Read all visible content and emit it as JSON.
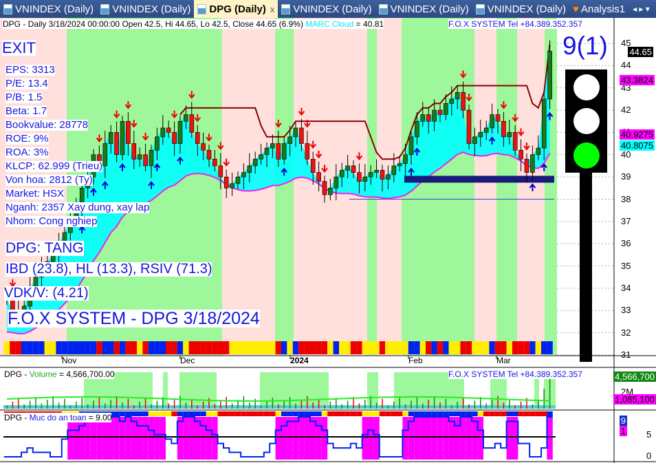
{
  "tabs": [
    {
      "label": "VNINDEX (Daily)"
    },
    {
      "label": "VNINDEX (Daily)"
    },
    {
      "label": "DPG (Daily)",
      "active": true
    },
    {
      "label": "VNINDEX (Daily)"
    },
    {
      "label": "VNINDEX (Daily)"
    },
    {
      "label": "VNINDEX (Daily)"
    },
    {
      "label": "Analysis1"
    }
  ],
  "tab_close": "x",
  "tab_nav": "◂ ▸ ▾",
  "header": {
    "text": "DPG - Daily 3/18/2024 00:00:00 Open 42.5, Hi 44.65, Lo 42.5, Close 44.65 (6.9%)",
    "marc_label": "MARC Cloud",
    "marc_value": "= 40.81",
    "fox": "F.O.X SYSTEM Tel +84.389.352.357"
  },
  "signal": "EXIT",
  "fundamentals": [
    "EPS: 3313",
    "P/E: 13.4",
    "P/B: 1.5",
    "Beta: 1.7",
    "Bookvalue: 28778",
    "ROE: 9%",
    "ROA: 3%",
    "KLCP: 62.999 (Trieu)",
    "Von hoa: 2812 (Ty)",
    "Market: HSX",
    "Nganh: 2357 Xay dung, xay lap",
    "Nhom: Cong nghiep"
  ],
  "trend": "DPG: TANG",
  "ratings": "IBD (23.8), HL (13.3), RSIV (71.3)",
  "vdk": "VDK/V:  (4.21)",
  "footer_title": "F.O.X SYSTEM - DPG 3/18/2024",
  "score": "9(1)",
  "price_tags": {
    "last": "44.65",
    "upper": "43.3824",
    "mid": "40.9275",
    "cloud": "40.8075"
  },
  "volume_pane": {
    "title": "DPG - ",
    "label": "Volume",
    "value": "= 4,566,700.00",
    "fox": "F.O.X SYSTEM Tel +84.389.352.357",
    "tag_last": "4,566,700",
    "tag_avg": "1,085,100",
    "axis": "2M"
  },
  "safety_pane": {
    "title": "DPG - ",
    "label": "Muc do an toan",
    "value": "= 9.00",
    "tag_value": "9",
    "tag_signal": "1",
    "axis": [
      "5",
      "0"
    ]
  },
  "colors": {
    "up": "#1a7a1a",
    "down": "#ee1111",
    "green_band": "#9ef79a",
    "pink_band": "#ffe0dc",
    "marc": "#ee22ee",
    "cloud": "#00ffff"
  },
  "chart_data": {
    "type": "candlestick",
    "title": "DPG - Daily",
    "x_labels": [
      "Nov",
      "Dec",
      "2024",
      "Feb",
      "Mar"
    ],
    "y_ticks": [
      31,
      32,
      33,
      34,
      35,
      36,
      37,
      38,
      39,
      40,
      41,
      42,
      43,
      44,
      45
    ],
    "ylim": [
      31,
      45
    ],
    "closes": [
      33.5,
      33,
      32.8,
      33.2,
      34,
      34.5,
      35,
      35.2,
      35.5,
      36,
      36.5,
      37,
      37.5,
      38.5,
      39,
      40,
      39.5,
      40.5,
      41,
      40,
      41.5,
      40.5,
      39.8,
      40,
      39.5,
      40.2,
      40.8,
      41.2,
      41,
      40.5,
      41.5,
      41.8,
      41,
      40.5,
      40.2,
      39.8,
      39.5,
      39,
      38.5,
      38.7,
      39,
      39.2,
      39.5,
      39.8,
      40,
      40.3,
      40.5,
      39.8,
      40.5,
      40.8,
      41.2,
      40.5,
      39.8,
      39.2,
      38.8,
      38.2,
      38.5,
      39,
      39.3,
      39.5,
      39.2,
      38.8,
      39,
      39.2,
      39.3,
      38.9,
      39.1,
      39.5,
      39.6,
      40,
      40.8,
      41.5,
      41.8,
      41.5,
      42,
      41.8,
      42.3,
      42.5,
      42.8,
      42,
      40.5,
      40.8,
      41,
      41.2,
      41.8,
      41.5,
      40.8,
      41,
      40.2,
      39.8,
      39.2,
      40,
      40.3,
      42.5,
      44.65
    ],
    "last_open": 42.5,
    "safety_levels": [
      0,
      0,
      0,
      1,
      2,
      1,
      1,
      1,
      0,
      0,
      4,
      6,
      6,
      7,
      8,
      8,
      8,
      9,
      9,
      9,
      8,
      9,
      8,
      7,
      7,
      6,
      5,
      5,
      4,
      3,
      8,
      9,
      9,
      8,
      7,
      6,
      5,
      3,
      2,
      1,
      1,
      0,
      0,
      0,
      0,
      1,
      3,
      6,
      7,
      8,
      8,
      9,
      9,
      8,
      7,
      6,
      3,
      2,
      2,
      2,
      3,
      2,
      5,
      6,
      5,
      0,
      0,
      0,
      0,
      6,
      8,
      9,
      9,
      9,
      9,
      9,
      9,
      8,
      7,
      9,
      9,
      8,
      6,
      2,
      2,
      3,
      2,
      8,
      8,
      3,
      3,
      0,
      0,
      2,
      9
    ],
    "volume_last": 4566700,
    "volume_avg": 1085100
  }
}
